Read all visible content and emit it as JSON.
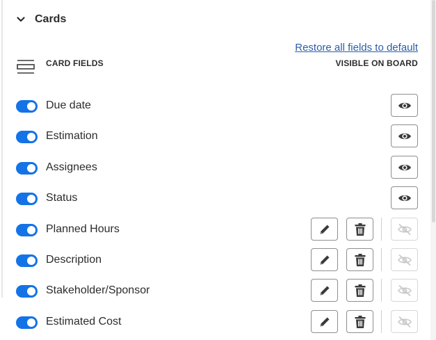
{
  "section": {
    "title": "Cards",
    "collapse_icon": "chevron-down-icon"
  },
  "header": {
    "restore_link": "Restore all fields to default",
    "card_fields_label": "CARD FIELDS",
    "visible_on_board_label": "VISIBLE ON BOARD",
    "list_icon": "list-lines-icon"
  },
  "colors": {
    "toggle_on": "#1473e6",
    "link": "#2a5da8",
    "text": "#2c2c2c"
  },
  "fields": [
    {
      "label": "Due date",
      "enabled": true,
      "visible_on_board": true,
      "editable": false,
      "deletable": false
    },
    {
      "label": "Estimation",
      "enabled": true,
      "visible_on_board": true,
      "editable": false,
      "deletable": false
    },
    {
      "label": "Assignees",
      "enabled": true,
      "visible_on_board": true,
      "editable": false,
      "deletable": false
    },
    {
      "label": "Status",
      "enabled": true,
      "visible_on_board": true,
      "editable": false,
      "deletable": false
    },
    {
      "label": "Planned Hours",
      "enabled": true,
      "visible_on_board": false,
      "editable": true,
      "deletable": true
    },
    {
      "label": "Description",
      "enabled": true,
      "visible_on_board": false,
      "editable": true,
      "deletable": true
    },
    {
      "label": "Stakeholder/Sponsor",
      "enabled": true,
      "visible_on_board": false,
      "editable": true,
      "deletable": true
    },
    {
      "label": "Estimated Cost",
      "enabled": true,
      "visible_on_board": false,
      "editable": true,
      "deletable": true
    }
  ],
  "icons": {
    "edit": "pencil-icon",
    "delete": "trash-icon",
    "visible": "eye-icon",
    "hidden": "eye-off-icon"
  }
}
